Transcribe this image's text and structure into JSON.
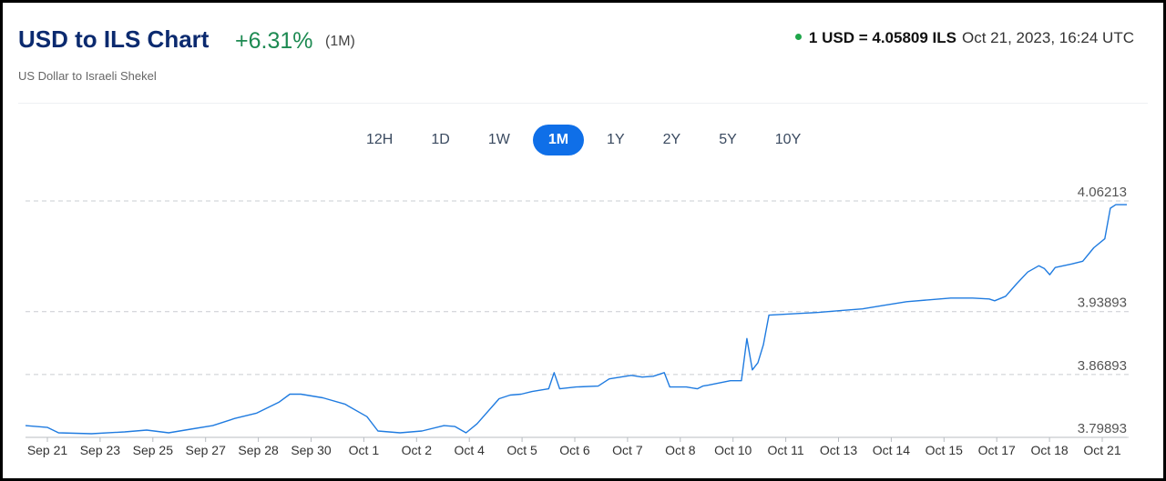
{
  "header": {
    "title": "USD to ILS Chart",
    "change": "+6.31%",
    "period": "(1M)",
    "subtitle": "US Dollar to Israeli Shekel",
    "rate": "1 USD = 4.05809 ILS",
    "timestamp": "Oct 21, 2023, 16:24 UTC"
  },
  "tabs": [
    {
      "label": "12H",
      "active": false
    },
    {
      "label": "1D",
      "active": false
    },
    {
      "label": "1W",
      "active": false
    },
    {
      "label": "1M",
      "active": true
    },
    {
      "label": "1Y",
      "active": false
    },
    {
      "label": "2Y",
      "active": false
    },
    {
      "label": "5Y",
      "active": false
    },
    {
      "label": "10Y",
      "active": false
    }
  ],
  "colors": {
    "line": "#1f7be0",
    "title": "#0b2a6f",
    "change": "#1d8a52",
    "active_tab": "#0f6fe8"
  },
  "chart_data": {
    "type": "line",
    "title": "USD to ILS Chart",
    "ylim": [
      3.79893,
      4.06213
    ],
    "yticks": [
      {
        "value": 4.06213,
        "label": "4.06213"
      },
      {
        "value": 3.93893,
        "label": "3.93893"
      },
      {
        "value": 3.86893,
        "label": "3.86893"
      },
      {
        "value": 3.79893,
        "label": "3.79893"
      }
    ],
    "xticks": [
      "Sep 21",
      "Sep 23",
      "Sep 25",
      "Sep 27",
      "Sep 28",
      "Sep 30",
      "Oct 1",
      "Oct 2",
      "Oct 4",
      "Oct 5",
      "Oct 6",
      "Oct 7",
      "Oct 8",
      "Oct 10",
      "Oct 11",
      "Oct 13",
      "Oct 14",
      "Oct 15",
      "Oct 17",
      "Oct 18",
      "Oct 21"
    ],
    "grid": "horizontal dashed",
    "series": [
      {
        "values": [
          [
            0,
            3.812
          ],
          [
            0.02,
            3.81
          ],
          [
            0.03,
            3.804
          ],
          [
            0.06,
            3.803
          ],
          [
            0.09,
            3.805
          ],
          [
            0.11,
            3.807
          ],
          [
            0.13,
            3.804
          ],
          [
            0.15,
            3.808
          ],
          [
            0.17,
            3.812
          ],
          [
            0.19,
            3.82
          ],
          [
            0.21,
            3.826
          ],
          [
            0.23,
            3.838
          ],
          [
            0.24,
            3.847
          ],
          [
            0.25,
            3.847
          ],
          [
            0.27,
            3.843
          ],
          [
            0.29,
            3.836
          ],
          [
            0.31,
            3.822
          ],
          [
            0.32,
            3.806
          ],
          [
            0.34,
            3.804
          ],
          [
            0.36,
            3.806
          ],
          [
            0.38,
            3.812
          ],
          [
            0.39,
            3.811
          ],
          [
            0.4,
            3.804
          ],
          [
            0.41,
            3.814
          ],
          [
            0.43,
            3.842
          ],
          [
            0.44,
            3.846
          ],
          [
            0.45,
            3.847
          ],
          [
            0.46,
            3.85
          ],
          [
            0.475,
            3.853
          ],
          [
            0.48,
            3.871
          ],
          [
            0.485,
            3.853
          ],
          [
            0.5,
            3.855
          ],
          [
            0.52,
            3.856
          ],
          [
            0.53,
            3.864
          ],
          [
            0.55,
            3.868
          ],
          [
            0.56,
            3.866
          ],
          [
            0.57,
            3.867
          ],
          [
            0.58,
            3.871
          ],
          [
            0.585,
            3.855
          ],
          [
            0.6,
            3.855
          ],
          [
            0.61,
            3.853
          ],
          [
            0.615,
            3.856
          ],
          [
            0.62,
            3.857
          ],
          [
            0.64,
            3.862
          ],
          [
            0.65,
            3.862
          ],
          [
            0.655,
            3.909
          ],
          [
            0.66,
            3.874
          ],
          [
            0.665,
            3.882
          ],
          [
            0.67,
            3.902
          ],
          [
            0.675,
            3.935
          ],
          [
            0.69,
            3.936
          ],
          [
            0.705,
            3.937
          ],
          [
            0.72,
            3.938
          ],
          [
            0.74,
            3.94
          ],
          [
            0.76,
            3.942
          ],
          [
            0.78,
            3.946
          ],
          [
            0.8,
            3.95
          ],
          [
            0.82,
            3.952
          ],
          [
            0.84,
            3.954
          ],
          [
            0.86,
            3.954
          ],
          [
            0.875,
            3.953
          ],
          [
            0.88,
            3.951
          ],
          [
            0.89,
            3.956
          ],
          [
            0.9,
            3.97
          ],
          [
            0.91,
            3.983
          ],
          [
            0.92,
            3.99
          ],
          [
            0.925,
            3.987
          ],
          [
            0.93,
            3.98
          ],
          [
            0.935,
            3.988
          ],
          [
            0.95,
            3.992
          ],
          [
            0.96,
            3.995
          ],
          [
            0.97,
            4.01
          ],
          [
            0.98,
            4.02
          ],
          [
            0.985,
            4.054
          ],
          [
            0.99,
            4.058
          ],
          [
            1.0,
            4.058
          ]
        ]
      }
    ]
  }
}
